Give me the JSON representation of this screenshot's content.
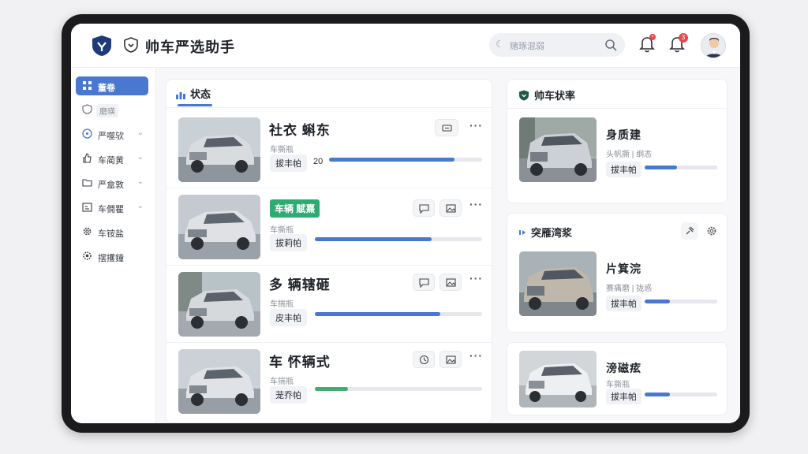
{
  "app": {
    "title": "帅车严选助手"
  },
  "search": {
    "placeholder": "赌琢混弱"
  },
  "notifications": {
    "badge_1": "•",
    "badge_2": "3"
  },
  "sidebar": {
    "items": [
      {
        "label": "董卷",
        "icon": "grid-icon",
        "active": true
      },
      {
        "label": "磨瑛",
        "icon": "shield-icon",
        "sub": true
      },
      {
        "label": "严噬欤",
        "icon": "clock-icon",
        "chevron": true
      },
      {
        "label": "车蔺黄",
        "icon": "thumb-icon",
        "chevron": true
      },
      {
        "label": "严盒敦",
        "icon": "folder-icon",
        "chevron": true
      },
      {
        "label": "车僩瞿",
        "icon": "calendar-icon",
        "chevron": true
      },
      {
        "label": "车铵盐",
        "icon": "gear-icon"
      },
      {
        "label": "摆攫鐘",
        "icon": "cog-icon"
      }
    ]
  },
  "feed": {
    "tab_label": "状态",
    "rows": [
      {
        "name": "社衣 蝌东",
        "sub": "车撕瓶",
        "chip": "拔丰帕",
        "num": "20",
        "progress": 0.82,
        "bar_color": "#4a78d0"
      },
      {
        "tag": "车辆 赋熹",
        "sub": "车撕瓶",
        "chip": "拔莉帕",
        "progress": 0.7,
        "bar_color": "#4a78d0"
      },
      {
        "name": "多 辆辖砸",
        "sub": "车揣瓶",
        "chip": "皮丰帕",
        "progress": 0.75,
        "bar_color": "#4a78d0"
      },
      {
        "name": "车 怀辆式",
        "sub": "车揣瓶",
        "chip": "茏乔帕",
        "progress": 0.2,
        "bar_color": "#3fae6f"
      }
    ]
  },
  "right": {
    "status_card": {
      "title": "帅车状率",
      "name": "身质建",
      "sub": "头帆撕 | 纲态",
      "chip": "拔丰帕",
      "progress": 0.45
    },
    "recommend_card": {
      "title": "突雁湾浆",
      "name": "片箕浣",
      "sub": "赛痛磨 | 拢惑",
      "chip": "拔丰帕",
      "progress": 0.35
    },
    "third_card": {
      "name": "滂磁痃",
      "sub": "车撕瓶",
      "chip": "拔丰帕",
      "progress": 0.35
    }
  }
}
